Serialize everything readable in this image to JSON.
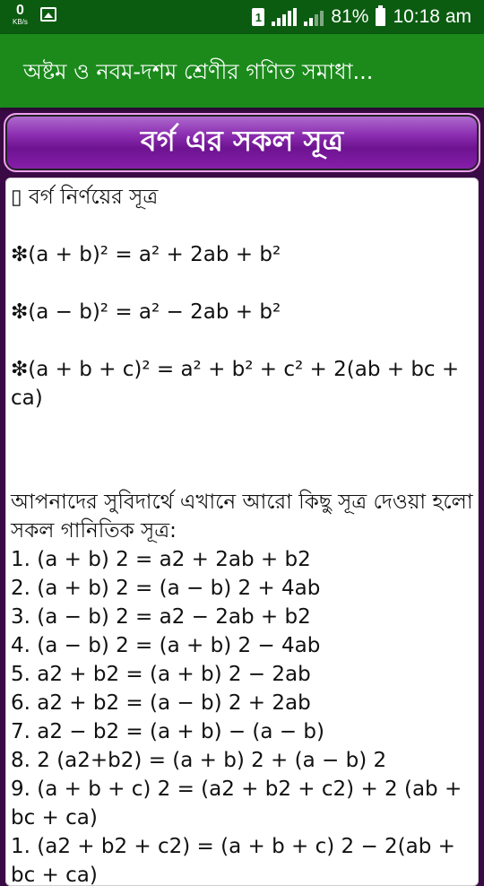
{
  "status_bar": {
    "data_speed": "0",
    "data_unit": "KB/s",
    "sim_label": "1",
    "battery_percent": "81%",
    "time": "10:18 am"
  },
  "app_bar": {
    "title": "অষ্টম ও নবম-দশম শ্রেণীর গণিত সমাধা..."
  },
  "header": {
    "title": "বর্গ এর সকল সূত্র"
  },
  "content": {
    "heading": "▯ বর্গ নির্ণয়ের সূত্র",
    "formulas": [
      "❇(a + b)² = a² + 2ab + b²",
      "❇(a − b)² = a² − 2ab + b²",
      "❇(a + b + c)² = a² + b² + c² + 2(ab + bc + ca)"
    ],
    "intro": "আপনাদের সুবিদার্থে এখানে আরো কিছু সূত্র দেওয়া হলো",
    "list_title": "সকল গানিতিক সূত্র:",
    "list": [
      "1. (a + b) 2 = a2 + 2ab + b2",
      "2. (a + b) 2 = (a − b) 2 + 4ab",
      "3. (a − b) 2 = a2 − 2ab + b2",
      "4. (a − b) 2 = (a + b) 2 − 4ab",
      "5. a2 + b2 = (a + b) 2 − 2ab",
      "6. a2 + b2 = (a − b) 2 + 2ab",
      "7. a2 − b2 = (a + b) − (a − b)",
      "8. 2 (a2+b2) = (a + b) 2 + (a − b) 2",
      "9. (a + b + c) 2 = (a2 + b2 + c2) + 2 (ab + bc + ca)",
      "1. (a2 + b2 + c2) = (a + b + c) 2 − 2(ab + bc + ca)"
    ]
  }
}
